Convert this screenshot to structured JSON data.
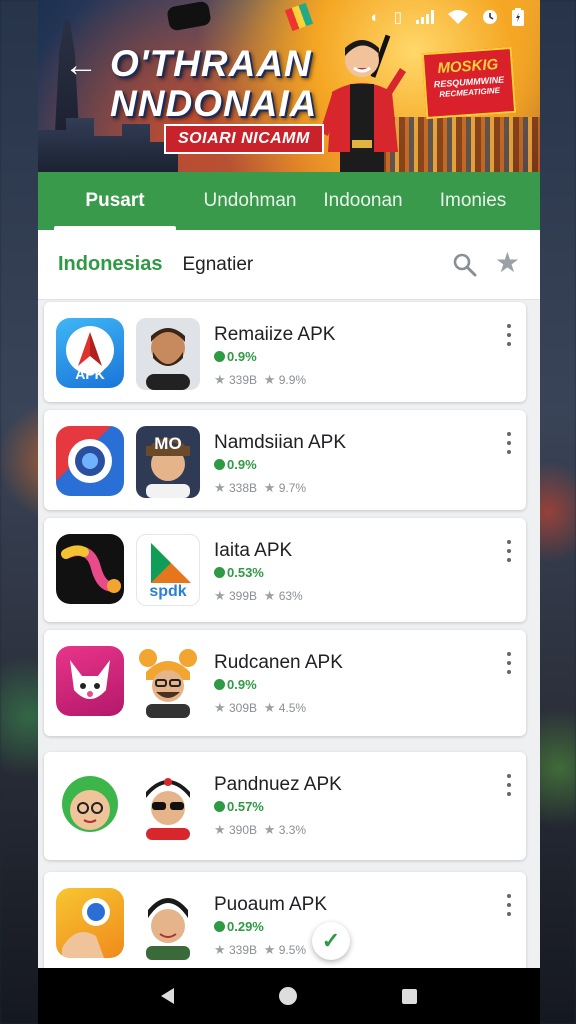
{
  "status_bar": {
    "icons": [
      "notification-icon",
      "vibrate-icon",
      "signal-icon",
      "wifi-icon",
      "alarm-icon",
      "battery-icon"
    ]
  },
  "banner": {
    "title_line1": "O'THRAAN",
    "title_line2": "NNDONAIA",
    "subtitle": "SOIARI NICAMM",
    "promo_line1": "MOSKIG",
    "promo_line2": "RESQUMMWINE",
    "promo_line3": "RECMEATIGINE"
  },
  "tabs": [
    {
      "label": "Pusart",
      "active": true
    },
    {
      "label": "Undohman",
      "active": false
    },
    {
      "label": "Indoonan",
      "active": false
    },
    {
      "label": "Imonies",
      "active": false
    }
  ],
  "filter": {
    "primary": "Indonesias",
    "secondary": "Egnatier"
  },
  "apps": [
    {
      "name": "Remaiize APK",
      "rating": "0.9%",
      "downloads": "339B",
      "score": "9.9%",
      "icon_label": "APK",
      "icon": "apk-arrow-icon",
      "avatar": "bearded-man-avatar"
    },
    {
      "name": "Namdsiian APK",
      "rating": "0.9%",
      "downloads": "338B",
      "score": "9.7%",
      "icon_label": "",
      "icon": "camera-lens-icon",
      "avatar": "cap-man-avatar",
      "avatar_text": "MO"
    },
    {
      "name": "Iaita APK",
      "rating": "0.53%",
      "downloads": "399B",
      "score": "63%",
      "icon_label": "",
      "icon": "colorful-snake-icon",
      "avatar": "play-triangle-avatar",
      "avatar_text": "spdk"
    },
    {
      "name": "Rudcanen APK",
      "rating": "0.9%",
      "downloads": "309B",
      "score": "4.5%",
      "icon_label": "",
      "icon": "white-fox-icon",
      "avatar": "bear-hat-man-avatar"
    },
    {
      "name": "Pandnuez APK",
      "rating": "0.57%",
      "downloads": "390B",
      "score": "3.3%",
      "icon_label": "",
      "icon": "green-hair-face-icon",
      "avatar": "sunglasses-man-avatar"
    },
    {
      "name": "Puoaum APK",
      "rating": "0.29%",
      "downloads": "339B",
      "score": "9.5%",
      "icon_label": "",
      "icon": "yellow-lens-icon",
      "avatar": "dark-hair-man-avatar"
    }
  ],
  "colors": {
    "accent_green": "#3a9a4b",
    "text_green": "#2e9a44",
    "promo_red": "#d9202b"
  }
}
